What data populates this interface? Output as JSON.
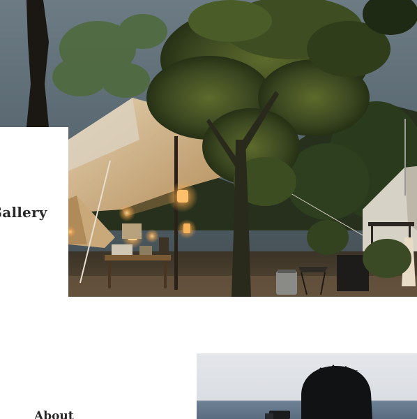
{
  "gallery": {
    "title": "Gallery"
  },
  "about": {
    "title": "About"
  },
  "colors": {
    "sky": "#5c6b74",
    "tent_canvas": "#c9a97a",
    "lantern_glow": "#f7a64a",
    "foliage": "#2d3a1f",
    "text": "#2a2a2a"
  }
}
